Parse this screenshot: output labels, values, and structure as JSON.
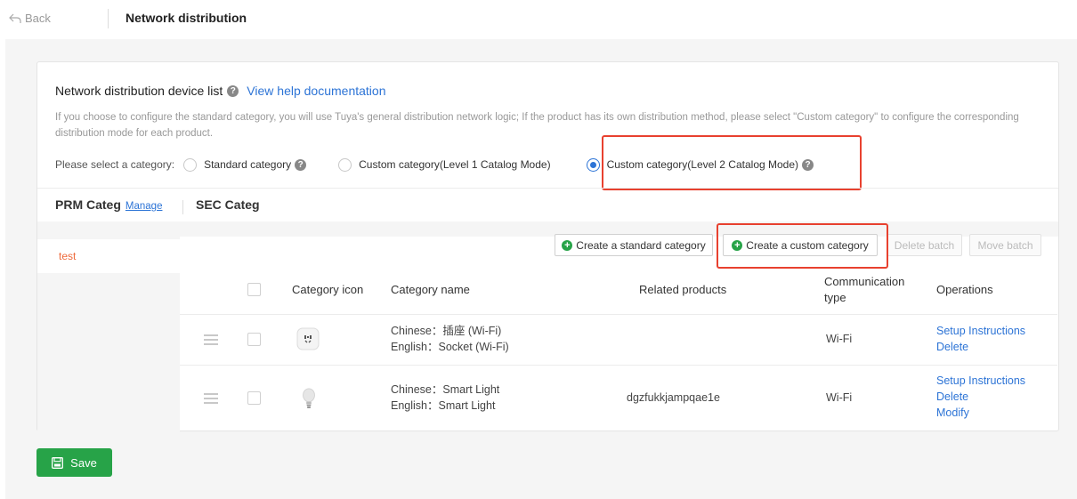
{
  "topbar": {
    "back_label": "Back",
    "title": "Network distribution"
  },
  "section": {
    "title": "Network distribution device list",
    "help_link": "View help documentation",
    "description": "If you choose to configure the standard category, you will use Tuya's general distribution network logic; If the product has its own distribution method, please select \"Custom category\" to configure the corresponding distribution mode for each product."
  },
  "category_select": {
    "label": "Please select a category:",
    "options": [
      {
        "label": "Standard category",
        "checked": false
      },
      {
        "label": "Custom category(Level 1 Catalog Mode)",
        "checked": false
      },
      {
        "label": "Custom category(Level 2 Catalog Mode)",
        "checked": true
      }
    ]
  },
  "primary": {
    "title": "PRM Categ",
    "manage_label": "Manage",
    "items": [
      "test"
    ]
  },
  "secondary": {
    "title": "SEC Categ"
  },
  "toolbar": {
    "create_standard": "Create a standard category",
    "create_custom": "Create a custom category",
    "delete_batch": "Delete batch",
    "move_batch": "Move batch"
  },
  "table": {
    "headers": {
      "icon": "Category icon",
      "name": "Category name",
      "products": "Related products",
      "comm_line1": "Communication",
      "comm_line2": "type",
      "ops": "Operations"
    },
    "rows": [
      {
        "icon": "socket-icon",
        "name_cn": "Chinese：插座 (Wi-Fi)",
        "name_en": "English：Socket (Wi-Fi)",
        "products": "",
        "comm": "Wi-Fi",
        "ops": [
          "Setup Instructions",
          "Delete"
        ]
      },
      {
        "icon": "bulb-icon",
        "name_cn": "Chinese：Smart Light",
        "name_en": "English：Smart Light",
        "products": "dgzfukkjampqae1e",
        "comm": "Wi-Fi",
        "ops": [
          "Setup Instructions",
          "Delete",
          "Modify"
        ]
      }
    ]
  },
  "footer": {
    "save_label": "Save"
  },
  "colors": {
    "accent": "#2d74d6",
    "success": "#27a348",
    "highlight": "#e8412f",
    "primary_item": "#ee6a3c"
  }
}
